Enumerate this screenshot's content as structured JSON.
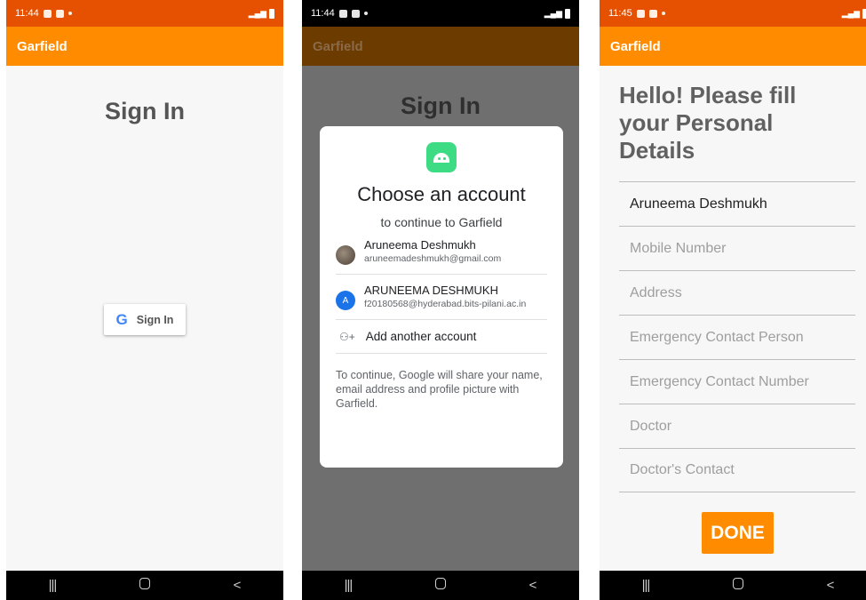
{
  "screen1": {
    "status_time": "11:44",
    "app_title": "Garfield",
    "heading": "Sign In",
    "google_button_label": "Sign In",
    "google_logo": "G"
  },
  "screen2": {
    "status_time": "11:44",
    "app_title": "Garfield",
    "heading": "Sign In",
    "dialog": {
      "title": "Choose an account",
      "subtitle": "to continue to Garfield",
      "accounts": [
        {
          "name": "Aruneema Deshmukh",
          "email": "aruneemadeshmukh@gmail.com",
          "avatar": "photo"
        },
        {
          "name": "ARUNEEMA DESHMUKH",
          "email": "f20180568@hyderabad.bits-pilani.ac.in",
          "avatar_initial": "A"
        }
      ],
      "add_account": "Add another account",
      "consent": "To continue, Google will share your name, email address and profile picture with Garfield."
    }
  },
  "screen3": {
    "status_time": "11:45",
    "app_title": "Garfield",
    "heading": "Hello! Please fill your Personal Details",
    "name_value": "Aruneema Deshmukh",
    "placeholders": {
      "mobile": "Mobile Number",
      "address": "Address",
      "emergency_person": "Emergency Contact Person",
      "emergency_number": "Emergency Contact Number",
      "doctor": "Doctor",
      "doctor_contact": "Doctor's Contact"
    },
    "done_label": "DONE"
  },
  "navbar": {
    "recent": "|||",
    "back": "<"
  },
  "colors": {
    "accent": "#ff8c00",
    "status_bar": "#e55100",
    "dim_appbar": "#6b3b00",
    "google_blue": "#4285f4",
    "android_green": "#3ddc84"
  }
}
